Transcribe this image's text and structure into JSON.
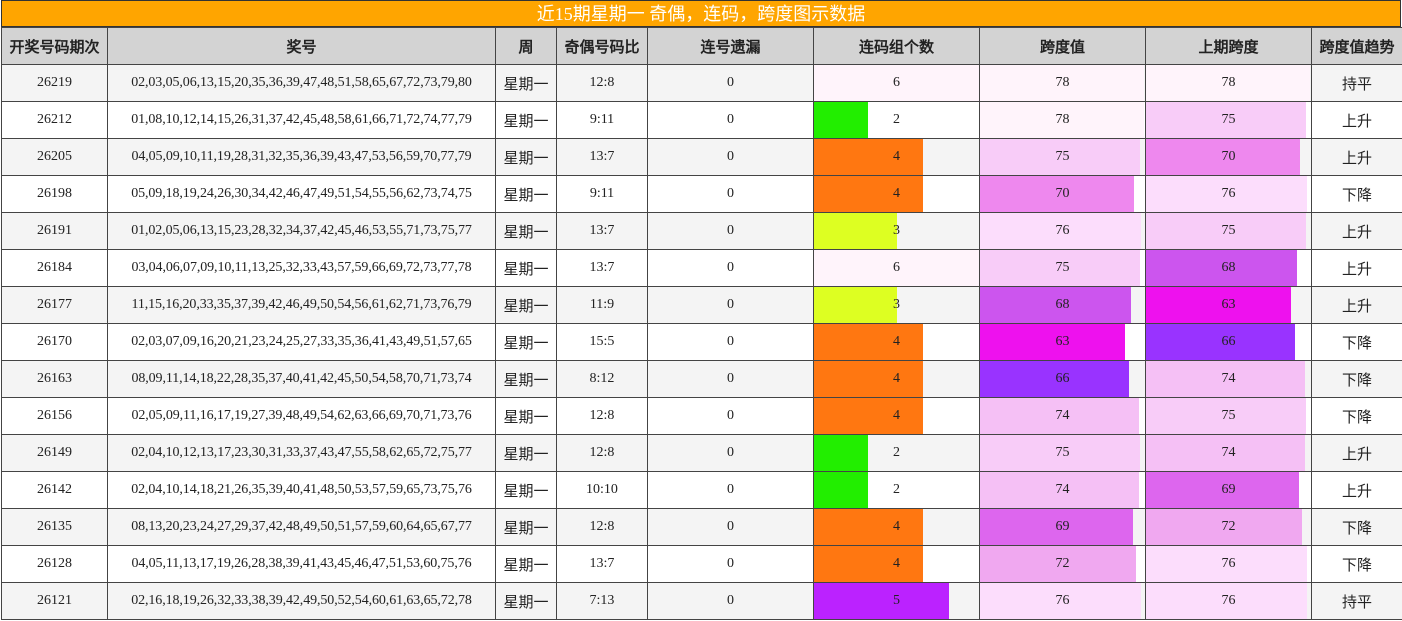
{
  "title": "近15期星期一 奇偶，连码，跨度图示数据",
  "headers": [
    "开奖号码期次",
    "奖号",
    "周",
    "奇偶号码比",
    "连号遗漏",
    "连码组个数",
    "跨度值",
    "上期跨度",
    "跨度值趋势"
  ],
  "colors": {
    "title_bg": "#ffa500",
    "lianma": {
      "2": "#22ee00",
      "3": "#ddff22",
      "4": "#ff7711",
      "5": "#bb22ff",
      "6": "#fff4fb"
    },
    "span": {
      "63": "#ee11ee",
      "66": "#9933ff",
      "68": "#cc55ee",
      "69": "#dd66ee",
      "70": "#ee88ee",
      "72": "#f0a8f0",
      "74": "#f5c0f5",
      "75": "#f8ccf8",
      "76": "#fcddfc",
      "78": "#fff4fb"
    }
  },
  "rows": [
    {
      "issue": "26219",
      "numbers": "02,03,05,06,13,15,20,35,36,39,47,48,51,58,65,67,72,73,79,80",
      "week": "星期一",
      "ratio": "12:8",
      "miss": "0",
      "lianma": 6,
      "span": 78,
      "prev_span": 78,
      "trend": "持平"
    },
    {
      "issue": "26212",
      "numbers": "01,08,10,12,14,15,26,31,37,42,45,48,58,61,66,71,72,74,77,79",
      "week": "星期一",
      "ratio": "9:11",
      "miss": "0",
      "lianma": 2,
      "span": 78,
      "prev_span": 75,
      "trend": "上升"
    },
    {
      "issue": "26205",
      "numbers": "04,05,09,10,11,19,28,31,32,35,36,39,43,47,53,56,59,70,77,79",
      "week": "星期一",
      "ratio": "13:7",
      "miss": "0",
      "lianma": 4,
      "span": 75,
      "prev_span": 70,
      "trend": "上升"
    },
    {
      "issue": "26198",
      "numbers": "05,09,18,19,24,26,30,34,42,46,47,49,51,54,55,56,62,73,74,75",
      "week": "星期一",
      "ratio": "9:11",
      "miss": "0",
      "lianma": 4,
      "span": 70,
      "prev_span": 76,
      "trend": "下降"
    },
    {
      "issue": "26191",
      "numbers": "01,02,05,06,13,15,23,28,32,34,37,42,45,46,53,55,71,73,75,77",
      "week": "星期一",
      "ratio": "13:7",
      "miss": "0",
      "lianma": 3,
      "span": 76,
      "prev_span": 75,
      "trend": "上升"
    },
    {
      "issue": "26184",
      "numbers": "03,04,06,07,09,10,11,13,25,32,33,43,57,59,66,69,72,73,77,78",
      "week": "星期一",
      "ratio": "13:7",
      "miss": "0",
      "lianma": 6,
      "span": 75,
      "prev_span": 68,
      "trend": "上升"
    },
    {
      "issue": "26177",
      "numbers": "11,15,16,20,33,35,37,39,42,46,49,50,54,56,61,62,71,73,76,79",
      "week": "星期一",
      "ratio": "11:9",
      "miss": "0",
      "lianma": 3,
      "span": 68,
      "prev_span": 63,
      "trend": "上升"
    },
    {
      "issue": "26170",
      "numbers": "02,03,07,09,16,20,21,23,24,25,27,33,35,36,41,43,49,51,57,65",
      "week": "星期一",
      "ratio": "15:5",
      "miss": "0",
      "lianma": 4,
      "span": 63,
      "prev_span": 66,
      "trend": "下降"
    },
    {
      "issue": "26163",
      "numbers": "08,09,11,14,18,22,28,35,37,40,41,42,45,50,54,58,70,71,73,74",
      "week": "星期一",
      "ratio": "8:12",
      "miss": "0",
      "lianma": 4,
      "span": 66,
      "prev_span": 74,
      "trend": "下降"
    },
    {
      "issue": "26156",
      "numbers": "02,05,09,11,16,17,19,27,39,48,49,54,62,63,66,69,70,71,73,76",
      "week": "星期一",
      "ratio": "12:8",
      "miss": "0",
      "lianma": 4,
      "span": 74,
      "prev_span": 75,
      "trend": "下降"
    },
    {
      "issue": "26149",
      "numbers": "02,04,10,12,13,17,23,30,31,33,37,43,47,55,58,62,65,72,75,77",
      "week": "星期一",
      "ratio": "12:8",
      "miss": "0",
      "lianma": 2,
      "span": 75,
      "prev_span": 74,
      "trend": "上升"
    },
    {
      "issue": "26142",
      "numbers": "02,04,10,14,18,21,26,35,39,40,41,48,50,53,57,59,65,73,75,76",
      "week": "星期一",
      "ratio": "10:10",
      "miss": "0",
      "lianma": 2,
      "span": 74,
      "prev_span": 69,
      "trend": "上升"
    },
    {
      "issue": "26135",
      "numbers": "08,13,20,23,24,27,29,37,42,48,49,50,51,57,59,60,64,65,67,77",
      "week": "星期一",
      "ratio": "12:8",
      "miss": "0",
      "lianma": 4,
      "span": 69,
      "prev_span": 72,
      "trend": "下降"
    },
    {
      "issue": "26128",
      "numbers": "04,05,11,13,17,19,26,28,38,39,41,43,45,46,47,51,53,60,75,76",
      "week": "星期一",
      "ratio": "13:7",
      "miss": "0",
      "lianma": 4,
      "span": 72,
      "prev_span": 76,
      "trend": "下降"
    },
    {
      "issue": "26121",
      "numbers": "02,16,18,19,26,32,33,38,39,42,49,50,52,54,60,61,63,65,72,78",
      "week": "星期一",
      "ratio": "7:13",
      "miss": "0",
      "lianma": 5,
      "span": 76,
      "prev_span": 76,
      "trend": "持平"
    }
  ]
}
